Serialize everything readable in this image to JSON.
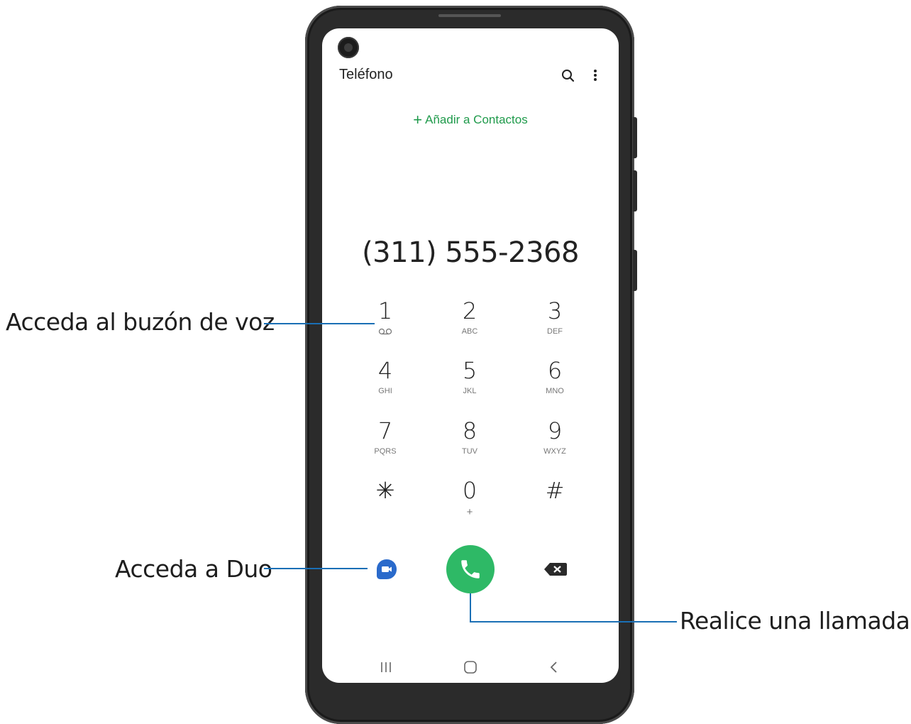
{
  "callouts": {
    "voicemail": "Acceda al buzón de voz",
    "duo": "Acceda a Duo",
    "call": "Realice una llamada"
  },
  "app": {
    "title": "Teléfono",
    "add_contact_label": "Añadir a Contactos",
    "dialed_number": "(311) 555-2368"
  },
  "keypad": [
    {
      "digit": "1",
      "letters": "",
      "icon": "voicemail-icon"
    },
    {
      "digit": "2",
      "letters": "ABC"
    },
    {
      "digit": "3",
      "letters": "DEF"
    },
    {
      "digit": "4",
      "letters": "GHI"
    },
    {
      "digit": "5",
      "letters": "JKL"
    },
    {
      "digit": "6",
      "letters": "MNO"
    },
    {
      "digit": "7",
      "letters": "PQRS"
    },
    {
      "digit": "8",
      "letters": "TUV"
    },
    {
      "digit": "9",
      "letters": "WXYZ"
    },
    {
      "digit": "✳",
      "letters": ""
    },
    {
      "digit": "0",
      "letters": "+"
    },
    {
      "digit": "#",
      "letters": ""
    }
  ],
  "icons": {
    "search": "search-icon",
    "more": "more-vertical-icon",
    "duo": "video-call-icon",
    "call": "phone-icon",
    "backspace": "backspace-icon",
    "nav_recents": "recents-icon",
    "nav_home": "home-icon",
    "nav_back": "back-icon"
  },
  "colors": {
    "accent_green": "#1f9a4b",
    "call_button": "#2eb966",
    "duo_blue": "#2a6acb",
    "callout_line": "#1a6fb5"
  }
}
